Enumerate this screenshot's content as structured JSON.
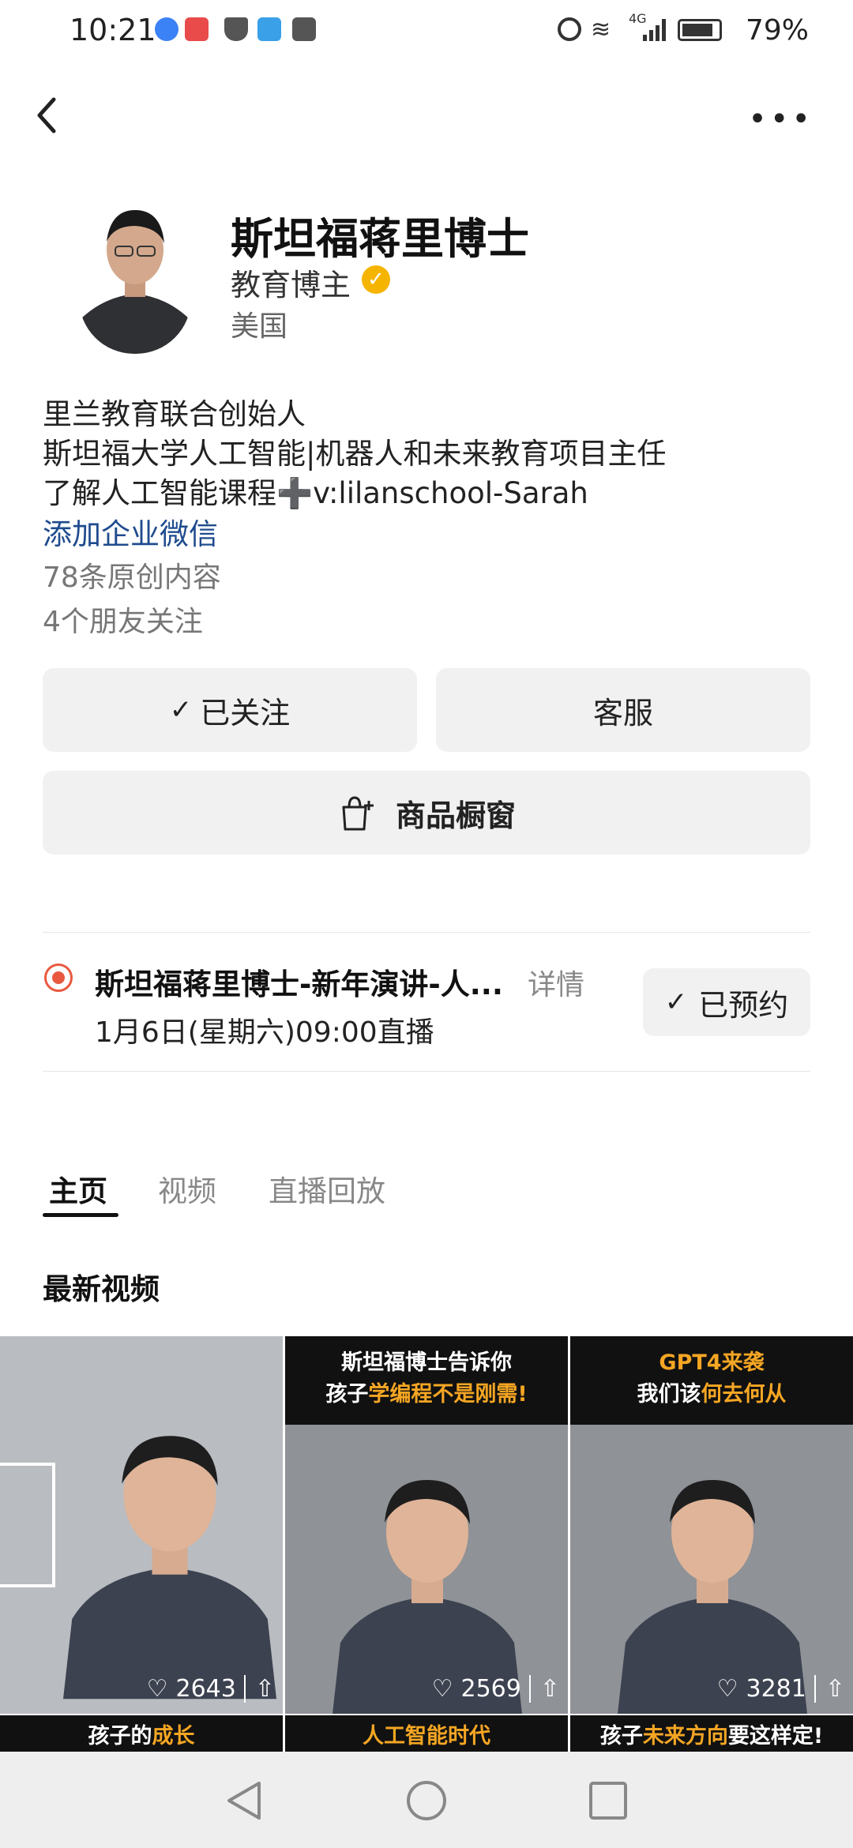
{
  "status_bar": {
    "time": "10:21",
    "battery": "79%",
    "network": "4G"
  },
  "header": {
    "back_icon": "back-arrow-icon",
    "more_icon": "more-dots-icon"
  },
  "profile": {
    "name": "斯坦福蒋里博士",
    "role": "教育博主",
    "region": "美国",
    "bio": [
      "里兰教育联合创始人",
      "斯坦福大学人工智能|机器人和未来教育项目主任",
      "了解人工智能课程➕v:lilanschool-Sarah"
    ],
    "enterprise_link": "添加企业微信",
    "original_count": "78条原创内容",
    "friends_following": "4个朋友关注"
  },
  "actions": {
    "followed": "已关注",
    "customer_service": "客服",
    "shop_window": "商品橱窗"
  },
  "live": {
    "title": "斯坦福蒋里博士-新年演讲-人...",
    "detail": "详情",
    "time": "1月6日(星期六)09:00直播",
    "reserved": "已预约"
  },
  "tabs": [
    "主页",
    "视频",
    "直播回放"
  ],
  "section_title": "最新视频",
  "videos": [
    {
      "top_line1": "",
      "top_line2": "",
      "likes": "2643",
      "bottom_a": "孩子的",
      "bottom_b": "成长",
      "bottom_c": ""
    },
    {
      "top_line1": "斯坦福博士告诉你",
      "top_line2a": "孩子",
      "top_line2b": "学编程不是刚需!",
      "likes": "2569",
      "bottom_a": "",
      "bottom_b": "人工智能时代",
      "bottom_c": ""
    },
    {
      "top_line1": "GPT4来袭",
      "top_line2a": "我们该",
      "top_line2b": "何去何从",
      "likes": "3281",
      "bottom_a": "孩子",
      "bottom_b": "未来方向",
      "bottom_c": "要这样定!"
    }
  ],
  "colors": {
    "accent_blue": "#1f4b8e",
    "live_red": "#e8593f",
    "highlight_orange": "#f5a623",
    "verified_gold": "#f5b400"
  }
}
